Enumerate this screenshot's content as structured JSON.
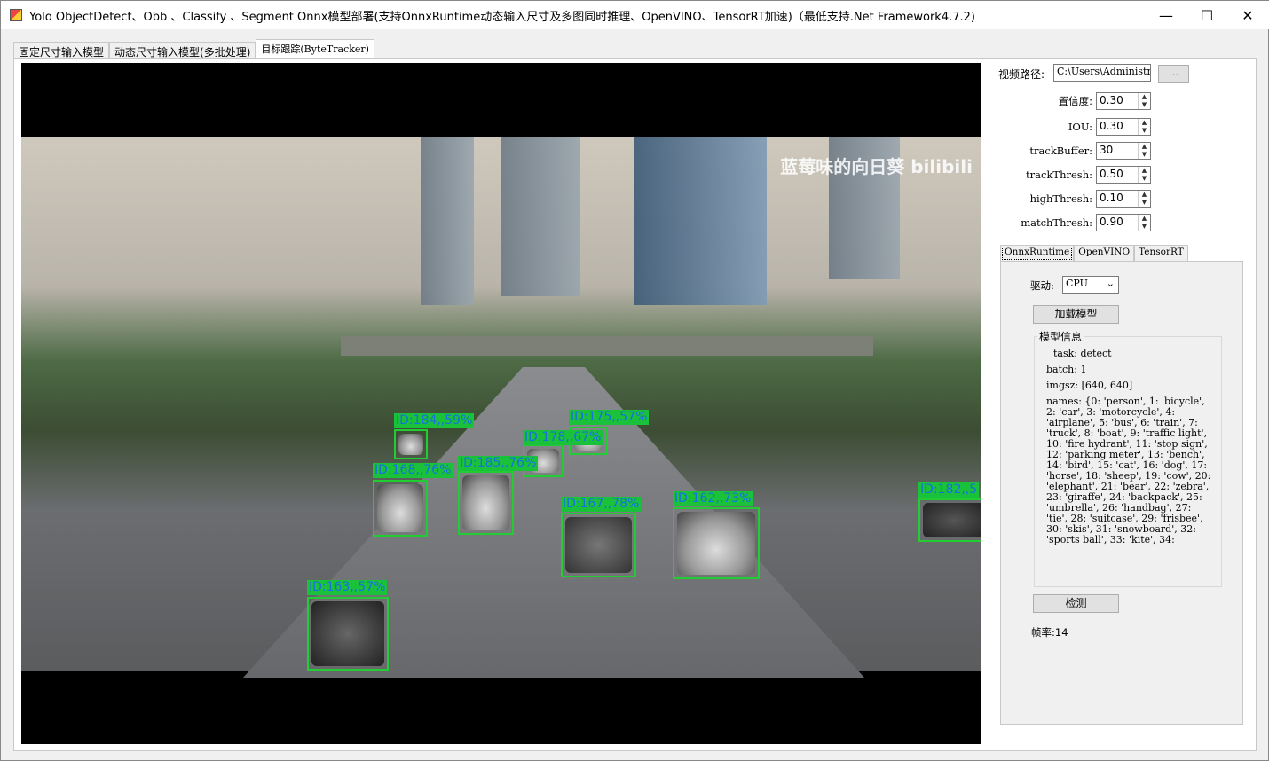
{
  "window": {
    "title": "Yolo ObjectDetect、Obb 、Classify 、Segment Onnx模型部署(支持OnnxRuntime动态输入尺寸及多图同时推理、OpenVINO、TensorRT加速)（最低支持.Net Framework4.7.2)",
    "minimize": "—",
    "maximize": "☐",
    "close": "✕"
  },
  "tabs": [
    "固定尺寸输入模型",
    "动态尺寸输入模型(多批处理)",
    "目标跟踪(ByteTracker)"
  ],
  "video": {
    "watermark": "蓝莓味的向日葵 bilibili",
    "detections": [
      {
        "label": "ID:184,,59%"
      },
      {
        "label": "ID:175,,57%"
      },
      {
        "label": "ID:178,,67%"
      },
      {
        "label": "ID:168,,76%"
      },
      {
        "label": "ID:185,,76%"
      },
      {
        "label": "ID:167,,78%"
      },
      {
        "label": "ID:162,,73%"
      },
      {
        "label": "ID:182,,5"
      },
      {
        "label": "ID:163,,57%"
      }
    ]
  },
  "settings": {
    "video_path_label": "视频路径:",
    "video_path_value": "C:\\Users\\Administr",
    "browse": "...",
    "fields": [
      {
        "label": "置信度:",
        "value": "0.30"
      },
      {
        "label": "IOU:",
        "value": "0.30"
      },
      {
        "label": "trackBuffer:",
        "value": "30"
      },
      {
        "label": "trackThresh:",
        "value": "0.50"
      },
      {
        "label": "highThresh:",
        "value": "0.10"
      },
      {
        "label": "matchThresh:",
        "value": "0.90"
      }
    ]
  },
  "engine_tabs": [
    "OnnxRuntime",
    "OpenVINO",
    "TensorRT"
  ],
  "engine": {
    "driver_label": "驱动:",
    "driver_value": "CPU",
    "load_model": "加载模型",
    "model_info_title": "模型信息",
    "task": "task: detect",
    "batch": "batch: 1",
    "imgsz": "imgsz: [640, 640]",
    "names": "names: {0: 'person', 1: 'bicycle', 2: 'car', 3: 'motorcycle', 4: 'airplane', 5: 'bus', 6: 'train', 7: 'truck', 8: 'boat', 9: 'traffic light', 10: 'fire hydrant', 11: 'stop sign', 12: 'parking meter', 13: 'bench', 14: 'bird', 15: 'cat', 16: 'dog', 17: 'horse', 18: 'sheep', 19: 'cow', 20: 'elephant', 21: 'bear', 22: 'zebra', 23: 'giraffe', 24: 'backpack', 25: 'umbrella', 26: 'handbag', 27: 'tie', 28: 'suitcase', 29: 'frisbee', 30: 'skis', 31: 'snowboard', 32: 'sports ball', 33: 'kite', 34:",
    "detect": "检测",
    "fps": "帧率:14"
  }
}
